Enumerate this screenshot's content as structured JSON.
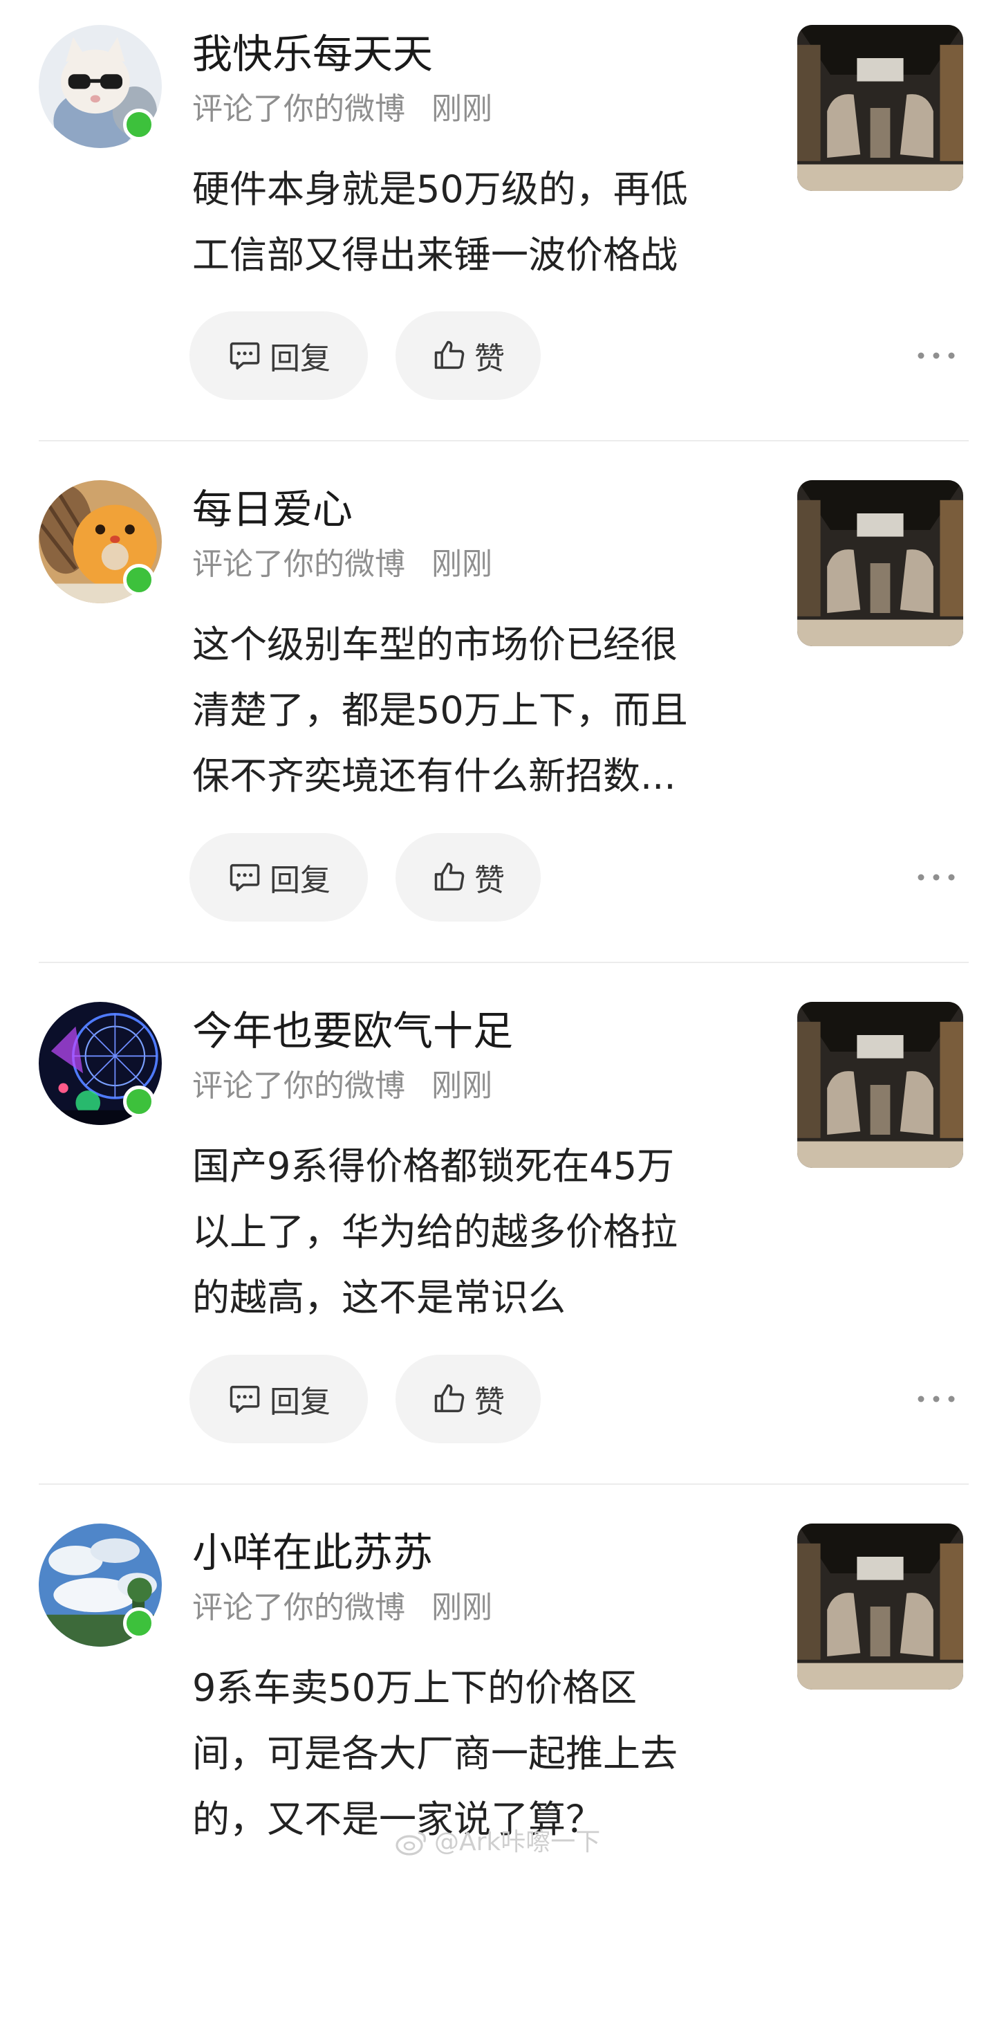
{
  "notifications": [
    {
      "username": "我快乐每天天",
      "action": "评论了你的微博",
      "time": "刚刚",
      "comment_lines": [
        "硬件本身就是50万级的，再低",
        "工信部又得出来锤一波价格战"
      ],
      "avatar_icon": "cat-with-sunglasses-avatar",
      "thumbnail_icon": "car-interior-thumbnail"
    },
    {
      "username": "每日爱心",
      "action": "评论了你的微博",
      "time": "刚刚",
      "comment_lines": [
        "这个级别车型的市场价已经很",
        "清楚了，都是50万上下，而且",
        "保不齐奕境还有什么新招数..."
      ],
      "avatar_icon": "donut-avatar",
      "thumbnail_icon": "car-interior-thumbnail"
    },
    {
      "username": "今年也要欧气十足",
      "action": "评论了你的微博",
      "time": "刚刚",
      "comment_lines": [
        "国产9系得价格都锁死在45万",
        "以上了，华为给的越多价格拉",
        "的越高，这不是常识么"
      ],
      "avatar_icon": "ferris-wheel-avatar",
      "thumbnail_icon": "car-interior-thumbnail"
    },
    {
      "username": "小咩在此苏苏",
      "action": "评论了你的微博",
      "time": "刚刚",
      "comment_lines": [
        "9系车卖50万上下的价格区",
        "间，可是各大厂商一起推上去",
        "的，又不是一家说了算？"
      ],
      "avatar_icon": "sky-clouds-avatar",
      "thumbnail_icon": "car-interior-thumbnail"
    }
  ],
  "actions": {
    "reply_label": "回复",
    "like_label": "赞"
  },
  "watermark": "@Ark咔嚓一下",
  "colors": {
    "online": "#3dc13c",
    "pill_bg": "#f3f3f3",
    "meta_text": "#8f8f8f",
    "divider": "#ececec"
  }
}
